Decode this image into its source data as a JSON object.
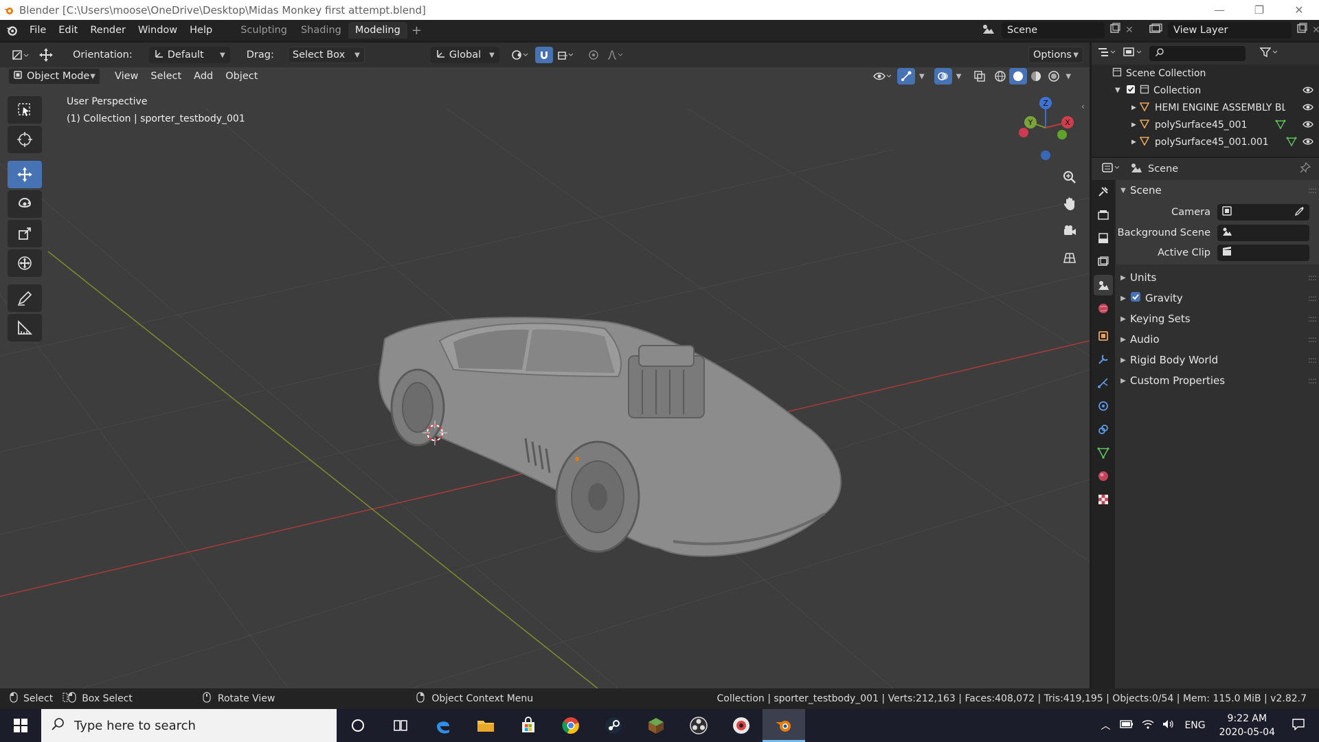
{
  "window": {
    "title": "Blender [C:\\Users\\moose\\OneDrive\\Desktop\\Midas Monkey first attempt.blend]",
    "min": "—",
    "restore": "❐",
    "close": "✕"
  },
  "topbar": {
    "menus": [
      "File",
      "Edit",
      "Render",
      "Window",
      "Help"
    ],
    "workspaces": [
      "Sculpting",
      "Shading",
      "Modeling"
    ],
    "active_workspace": "Modeling",
    "add_workspace": "+",
    "scene_name": "Scene",
    "view_layer_name": "View Layer"
  },
  "viewport_header": {
    "orientation_label": "Orientation:",
    "orientation_value": "Default",
    "drag_label": "Drag:",
    "drag_value": "Select Box",
    "transform_orientation": "Global",
    "options": "Options",
    "mode": "Object Mode",
    "menus": [
      "View",
      "Select",
      "Add",
      "Object"
    ]
  },
  "viewport": {
    "perspective": "User Perspective",
    "collection_info": "(1) Collection | sporter_testbody_001",
    "gizmo": {
      "z": "Z",
      "y": "Y",
      "x": "X"
    }
  },
  "outliner": {
    "root": "Scene Collection",
    "collection": "Collection",
    "items": [
      "HEMI ENGINE ASSEMBLY BLOW",
      "polySurface45_001",
      "polySurface45_001.001"
    ]
  },
  "properties": {
    "context": "Scene",
    "panel_title": "Scene",
    "fields": [
      {
        "label": "Camera"
      },
      {
        "label": "Background Scene"
      },
      {
        "label": "Active Clip"
      }
    ],
    "subpanels": [
      "Units",
      "Gravity",
      "Keying Sets",
      "Audio",
      "Rigid Body World",
      "Custom Properties"
    ],
    "gravity_checked": true
  },
  "statusbar": {
    "select": "Select",
    "box_select": "Box Select",
    "rotate_view": "Rotate View",
    "context_menu": "Object Context Menu",
    "stats": "Collection | sporter_testbody_001 | Verts:212,163 | Faces:408,072 | Tris:419,195 | Objects:0/54 | Mem: 115.0 MiB | v2.82.7"
  },
  "taskbar": {
    "search_placeholder": "Type here to search",
    "language": "ENG",
    "time": "9:22 AM",
    "date": "2020-05-04"
  },
  "colors": {
    "accent_blue": "#4772b3",
    "axis_x_red": "#b53a3a",
    "axis_y_green": "#7a9a2a",
    "blender_orange": "#e87d0d"
  }
}
